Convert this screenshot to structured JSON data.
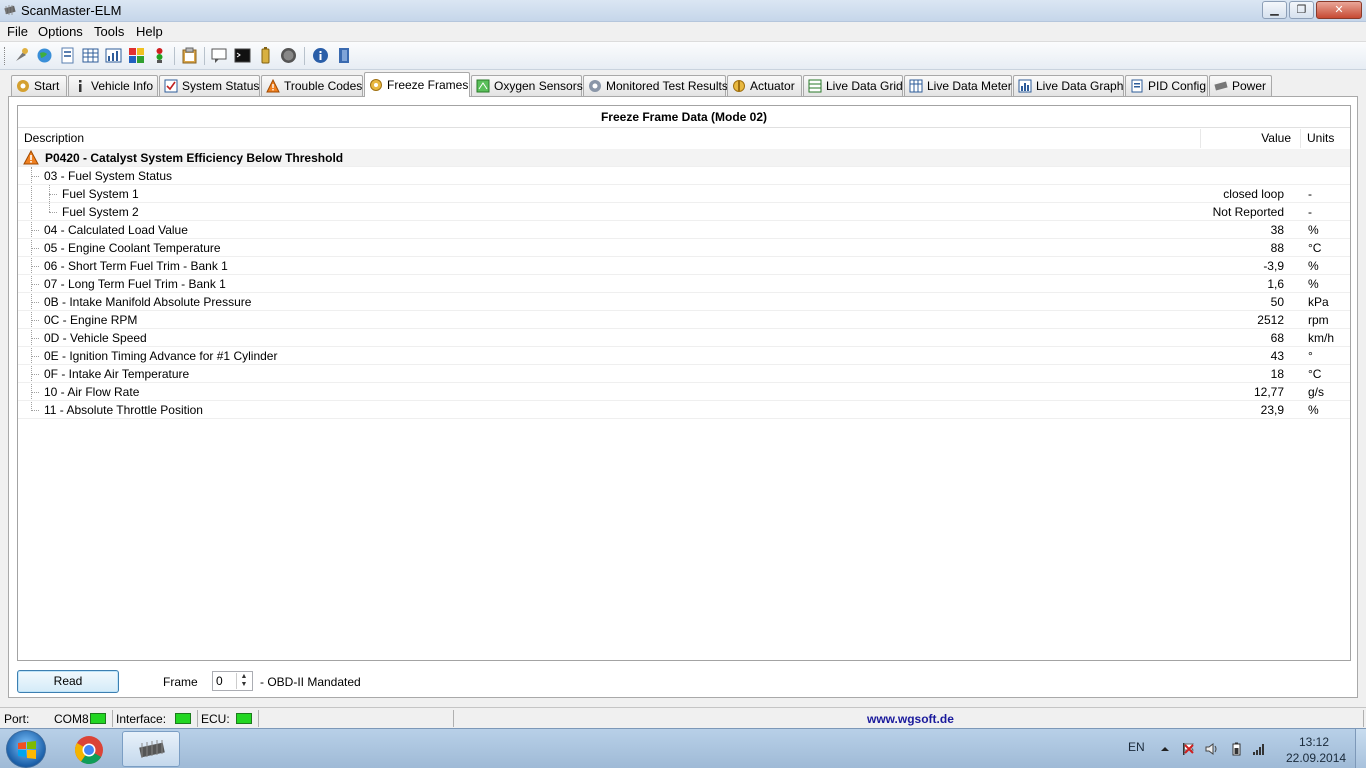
{
  "window": {
    "title": "ScanMaster-ELM",
    "minimize_glyph": "▁",
    "maximize_glyph": "❐",
    "close_glyph": "✕"
  },
  "menu": [
    "File",
    "Options",
    "Tools",
    "Help"
  ],
  "tabs": [
    {
      "label": "Start",
      "icon": "gear-icon",
      "active": false
    },
    {
      "label": "Vehicle Info",
      "icon": "info-icon",
      "active": false
    },
    {
      "label": "System Status",
      "icon": "checklist-icon",
      "active": false
    },
    {
      "label": "Trouble Codes",
      "icon": "warning-icon",
      "active": false
    },
    {
      "label": "Freeze Frames",
      "icon": "snowflake-icon",
      "active": true
    },
    {
      "label": "Oxygen Sensors",
      "icon": "sensor-icon",
      "active": false
    },
    {
      "label": "Monitored Test Results",
      "icon": "monitor-gear-icon",
      "active": false
    },
    {
      "label": "Actuator",
      "icon": "actuator-icon",
      "active": false
    },
    {
      "label": "Live Data Grid",
      "icon": "grid-icon",
      "active": false
    },
    {
      "label": "Live Data Meter",
      "icon": "meter-icon",
      "active": false
    },
    {
      "label": "Live Data Graph",
      "icon": "graph-icon",
      "active": false
    },
    {
      "label": "PID Config",
      "icon": "config-icon",
      "active": false
    },
    {
      "label": "Power",
      "icon": "chip-icon",
      "active": false
    }
  ],
  "grid": {
    "title": "Freeze Frame Data (Mode 02)",
    "columns": {
      "description": "Description",
      "value": "Value",
      "units": "Units"
    },
    "dtc": "P0420 - Catalyst System Efficiency Below Threshold",
    "rows": [
      {
        "desc": "03 - Fuel System Status",
        "value": "",
        "unit": "",
        "level": 1
      },
      {
        "desc": "Fuel System 1",
        "value": "closed loop",
        "unit": "-",
        "level": 2
      },
      {
        "desc": "Fuel System 2",
        "value": "Not Reported",
        "unit": "-",
        "level": 2
      },
      {
        "desc": "04 - Calculated Load Value",
        "value": "38",
        "unit": "%",
        "level": 1
      },
      {
        "desc": "05 - Engine Coolant Temperature",
        "value": "88",
        "unit": "°C",
        "level": 1
      },
      {
        "desc": "06 - Short Term Fuel Trim - Bank 1",
        "value": "-3,9",
        "unit": "%",
        "level": 1
      },
      {
        "desc": "07 - Long Term Fuel Trim - Bank 1",
        "value": "1,6",
        "unit": "%",
        "level": 1
      },
      {
        "desc": "0B - Intake Manifold Absolute Pressure",
        "value": "50",
        "unit": "kPa",
        "level": 1
      },
      {
        "desc": "0C - Engine RPM",
        "value": "2512",
        "unit": "rpm",
        "level": 1
      },
      {
        "desc": "0D - Vehicle Speed",
        "value": "68",
        "unit": "km/h",
        "level": 1
      },
      {
        "desc": "0E - Ignition Timing Advance for #1 Cylinder",
        "value": "43",
        "unit": "°",
        "level": 1
      },
      {
        "desc": "0F - Intake Air Temperature",
        "value": "18",
        "unit": "°C",
        "level": 1
      },
      {
        "desc": "10 - Air Flow Rate",
        "value": "12,77",
        "unit": "g/s",
        "level": 1
      },
      {
        "desc": "11 - Absolute Throttle Position",
        "value": "23,9",
        "unit": "%",
        "level": 1
      }
    ]
  },
  "controls": {
    "read_label": "Read",
    "frame_label": "Frame",
    "frame_value": "0",
    "frame_desc": "- OBD-II Mandated"
  },
  "status": {
    "port_label": "Port:",
    "port_value": "COM8",
    "interface_label": "Interface:",
    "ecu_label": "ECU:",
    "website": "www.wgsoft.de",
    "led_color": "#22d622"
  },
  "taskbar": {
    "language": "EN",
    "time": "13:12",
    "date": "22.09.2014"
  }
}
